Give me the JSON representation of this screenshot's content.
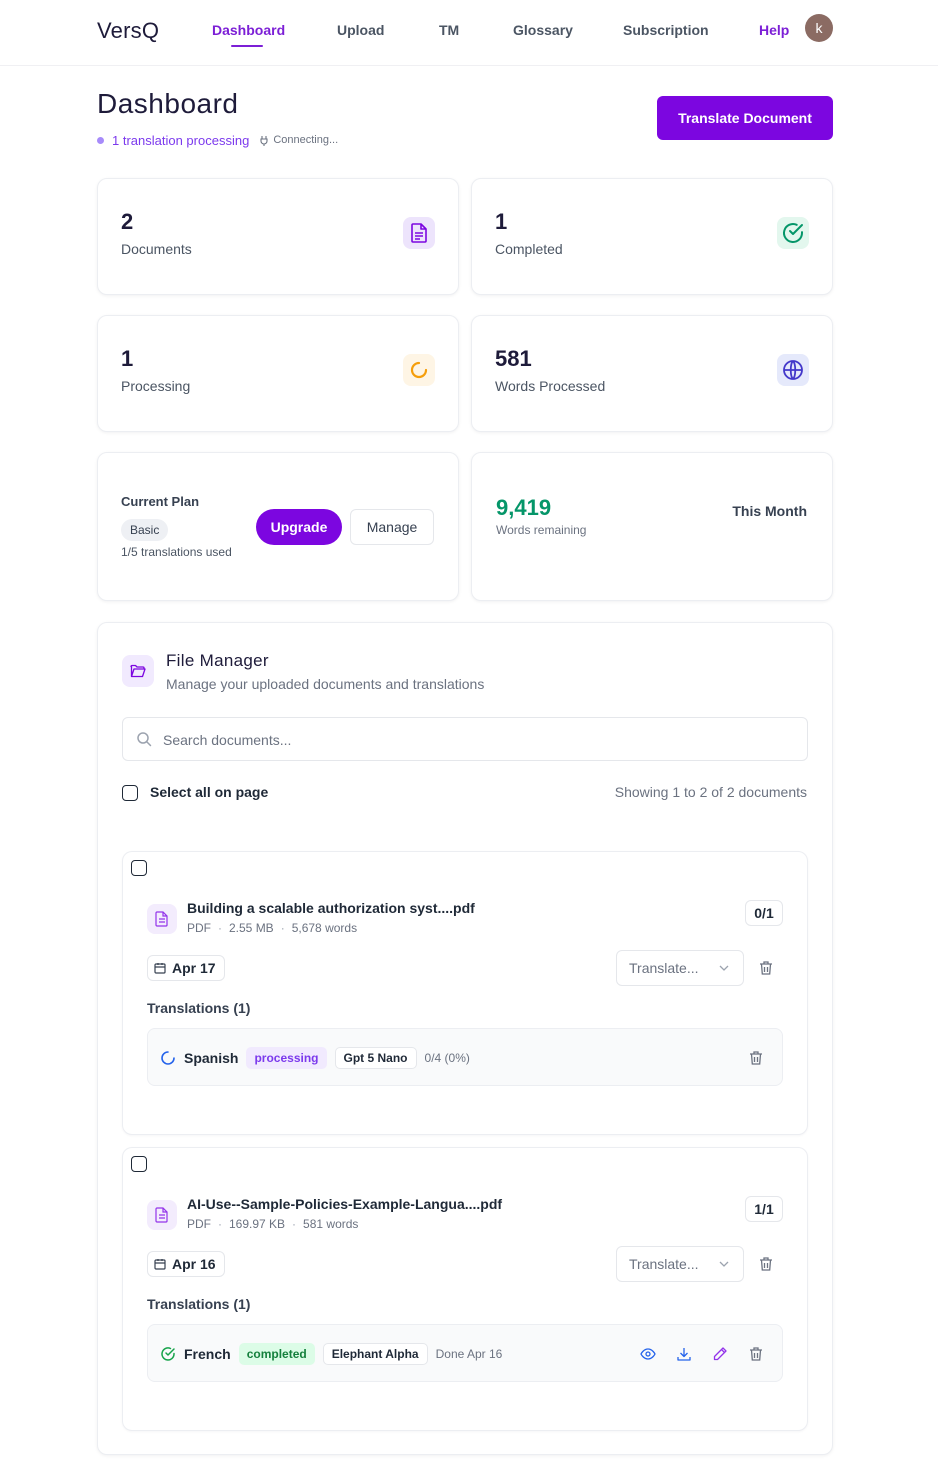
{
  "header": {
    "brand": "VersQ",
    "nav": [
      "Dashboard",
      "Upload",
      "TM",
      "Glossary",
      "Subscription",
      "Help"
    ],
    "active_nav": "Dashboard",
    "avatar_initial": "k"
  },
  "title_section": {
    "title": "Dashboard",
    "status": "1 translation processing",
    "connection": "Connecting...",
    "cta": "Translate Document"
  },
  "stats": [
    {
      "value": "2",
      "label": "Documents",
      "icon": "document-icon"
    },
    {
      "value": "1",
      "label": "Completed",
      "icon": "check-circle-icon"
    },
    {
      "value": "1",
      "label": "Processing",
      "icon": "spinner-icon"
    },
    {
      "value": "581",
      "label": "Words Processed",
      "icon": "globe-icon"
    }
  ],
  "plan": {
    "title": "Current Plan",
    "tier": "Basic",
    "usage": "1/5 translations used",
    "upgrade_label": "Upgrade",
    "manage_label": "Manage"
  },
  "words": {
    "remaining_value": "9,419",
    "remaining_label": "Words remaining",
    "period": "This Month"
  },
  "file_manager": {
    "title": "File Manager",
    "subtitle": "Manage your uploaded documents and translations",
    "search_placeholder": "Search documents...",
    "select_all_label": "Select all on page",
    "showing": "Showing 1 to 2 of 2 documents",
    "documents": [
      {
        "name": "Building a scalable authorization syst....pdf",
        "type": "PDF",
        "size": "2.55 MB",
        "words": "5,678 words",
        "count": "0/1",
        "date": "Apr 17",
        "translate_placeholder": "Translate...",
        "translations_heading": "Translations (1)",
        "translation": {
          "language": "Spanish",
          "status": "processing",
          "model": "Gpt 5 Nano",
          "progress": "0/4 (0%)"
        }
      },
      {
        "name": "AI-Use--Sample-Policies-Example-Langua....pdf",
        "type": "PDF",
        "size": "169.97 KB",
        "words": "581 words",
        "count": "1/1",
        "date": "Apr 16",
        "translate_placeholder": "Translate...",
        "translations_heading": "Translations (1)",
        "translation": {
          "language": "French",
          "status": "completed",
          "model": "Elephant Alpha",
          "progress": "Done Apr 16"
        }
      }
    ]
  },
  "colors": {
    "accent": "#7c06e0",
    "success": "#059669",
    "processing": "#7c3aed",
    "warning": "#f59e0b"
  }
}
